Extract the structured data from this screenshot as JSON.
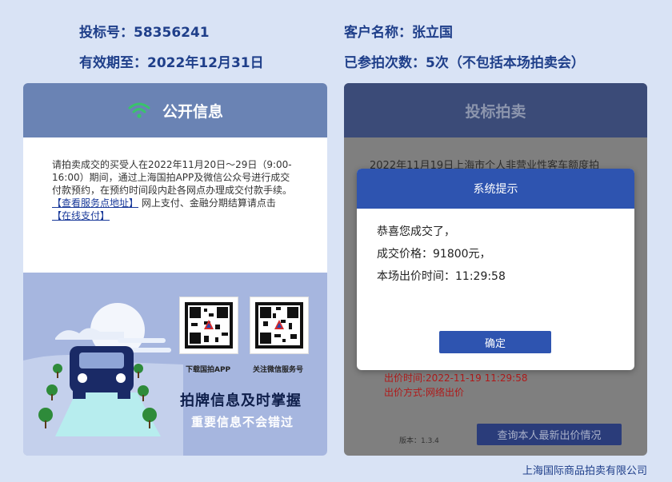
{
  "header": {
    "bid_no": "投标号：58356241",
    "customer": "客户名称：张立国",
    "valid_until": "有效期至：2022年12月31日",
    "attended": "已参拍次数：5次（不包括本场拍卖会）"
  },
  "public_info": {
    "title": "公开信息",
    "text": "请拍卖成交的买受人在2022年11月20日～29日（9:00-16:00）期间，通过上海国拍APP及微信公众号进行成交付款预约，在预约时间段内赴各网点办理成交付款手续。",
    "link_service": "【查看服务点地址】",
    "text2": " 网上支付、金融分期结算请点击",
    "link_pay": "【在线支付】",
    "qr1_label": "下载国拍APP",
    "qr2_label": "关注微信服务号",
    "slogan_main": "拍牌信息及时掌握",
    "slogan_sub": "重要信息不会错过"
  },
  "auction": {
    "title": "投标拍卖",
    "bg_title": "2022年11月19日上海市个人非营业性客车额度拍",
    "bid_time": "出价时间:2022-11-19 11:29:58",
    "bid_method": "出价方式:网络出价",
    "version": "版本：1.3.4",
    "query_button": "查询本人最新出价情况"
  },
  "modal": {
    "title": "系统提示",
    "line1": "恭喜您成交了，",
    "line2": "成交价格：91800元，",
    "line3": "本场出价时间：11:29:58",
    "ok": "确定"
  },
  "footer": "上海国际商品拍卖有限公司",
  "colors": {
    "accent": "#2e54b0",
    "wifi": "#39c46a"
  }
}
